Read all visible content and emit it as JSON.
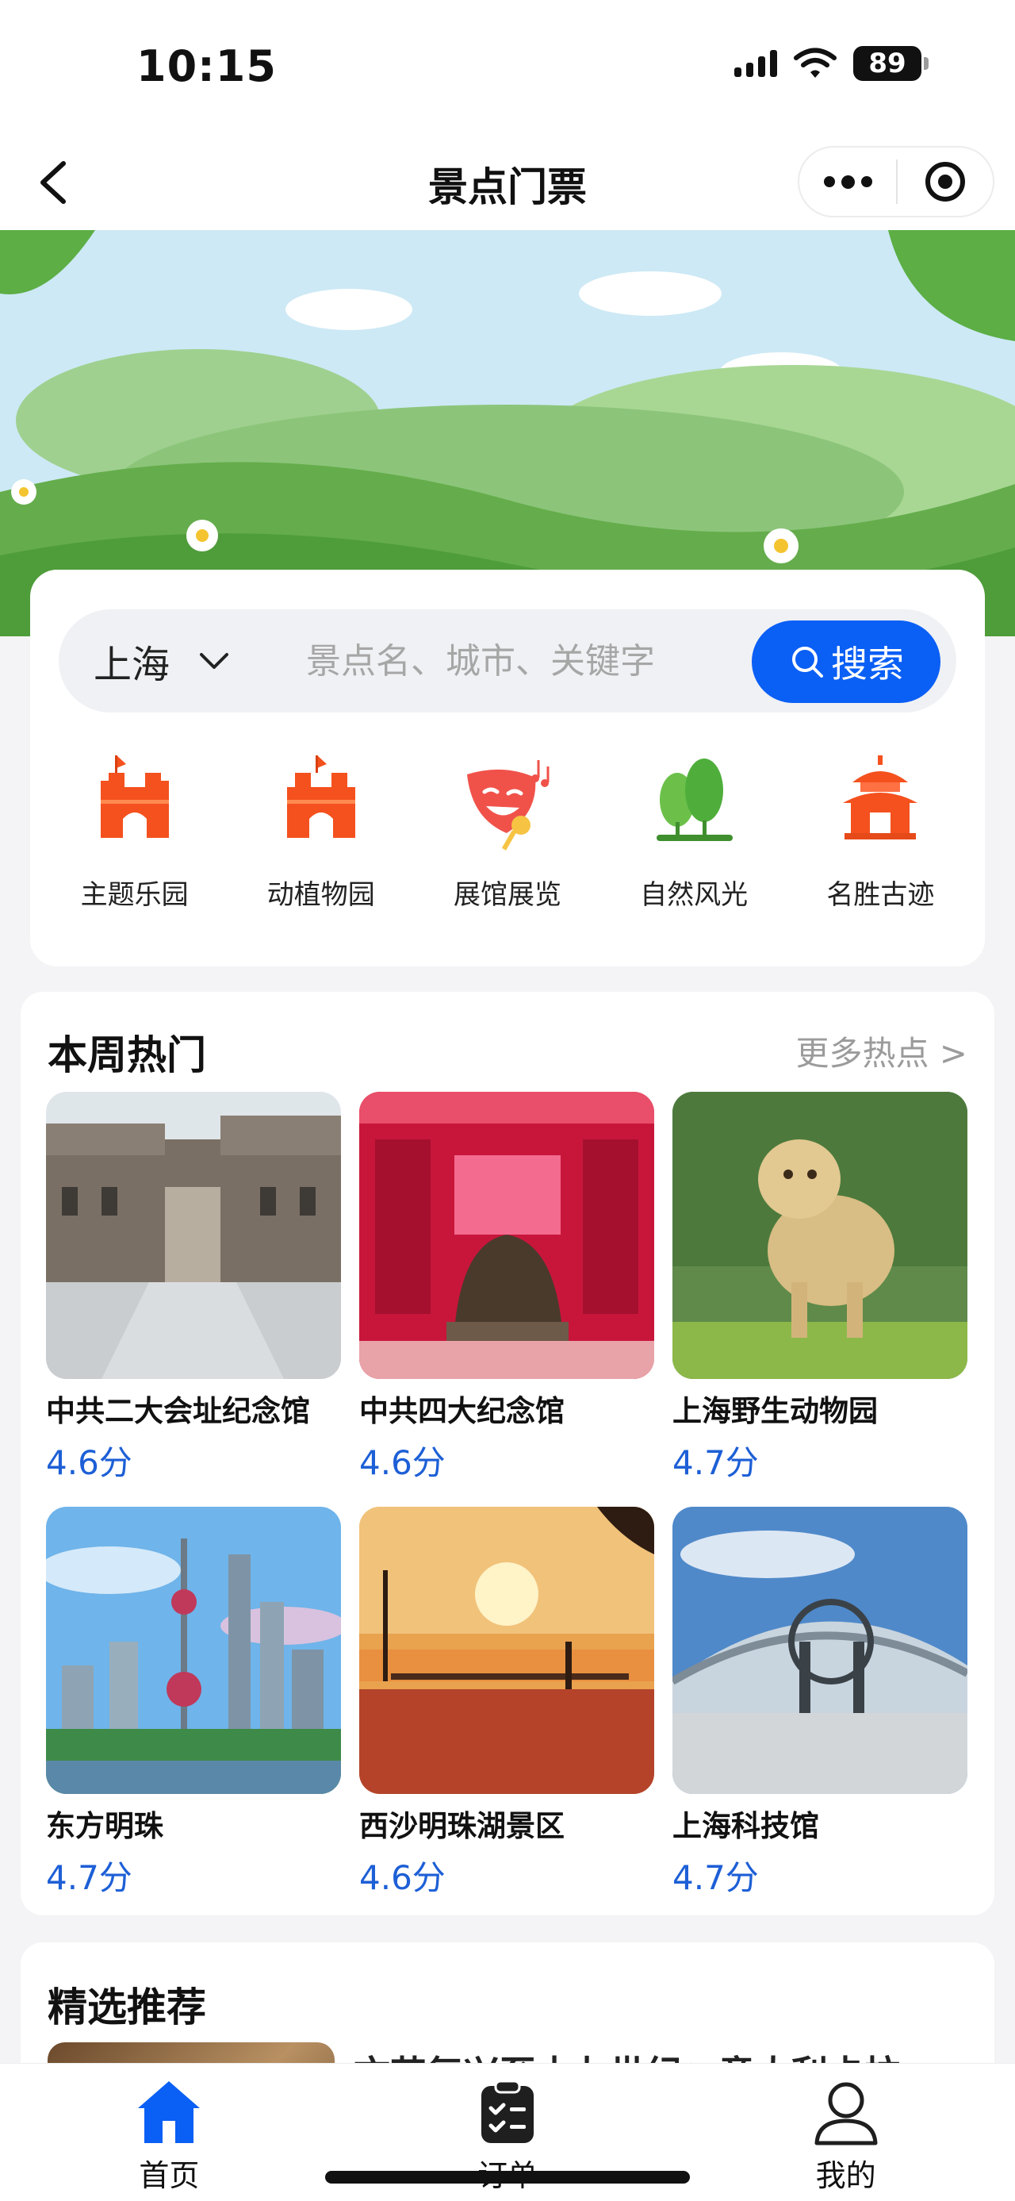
{
  "status_bar": {
    "time": "10:15",
    "battery": "89"
  },
  "nav": {
    "title": "景点门票"
  },
  "search": {
    "city": "上海",
    "placeholder": "景点名、城市、关键字",
    "button_label": "搜索"
  },
  "categories": [
    {
      "label": "主题乐园",
      "icon": "castle-icon"
    },
    {
      "label": "动植物园",
      "icon": "castle-icon"
    },
    {
      "label": "展馆展览",
      "icon": "theater-mask-icon"
    },
    {
      "label": "自然风光",
      "icon": "trees-icon"
    },
    {
      "label": "名胜古迹",
      "icon": "pavilion-icon"
    }
  ],
  "hot": {
    "title": "本周热门",
    "more_label": "更多热点 >",
    "items": [
      {
        "name": "中共二大会址纪念馆",
        "rating": "4.6分"
      },
      {
        "name": "中共四大纪念馆",
        "rating": "4.6分"
      },
      {
        "name": "上海野生动物园",
        "rating": "4.7分"
      },
      {
        "name": "东方明珠",
        "rating": "4.7分"
      },
      {
        "name": "西沙明珠湖景区",
        "rating": "4.6分"
      },
      {
        "name": "上海科技馆",
        "rating": "4.7分"
      }
    ]
  },
  "picks": {
    "title": "精选推荐",
    "first_title": "文艺复兴至十九世纪：意大利卡拉"
  },
  "tabs": [
    {
      "label": "首页",
      "icon": "home-icon",
      "active": true
    },
    {
      "label": "订单",
      "icon": "clipboard-check-icon",
      "active": false
    },
    {
      "label": "我的",
      "icon": "user-icon",
      "active": false
    }
  ],
  "colors": {
    "accent": "#0a5ff5",
    "rating": "#1d5fd6",
    "category_icon": "#f4511e"
  }
}
